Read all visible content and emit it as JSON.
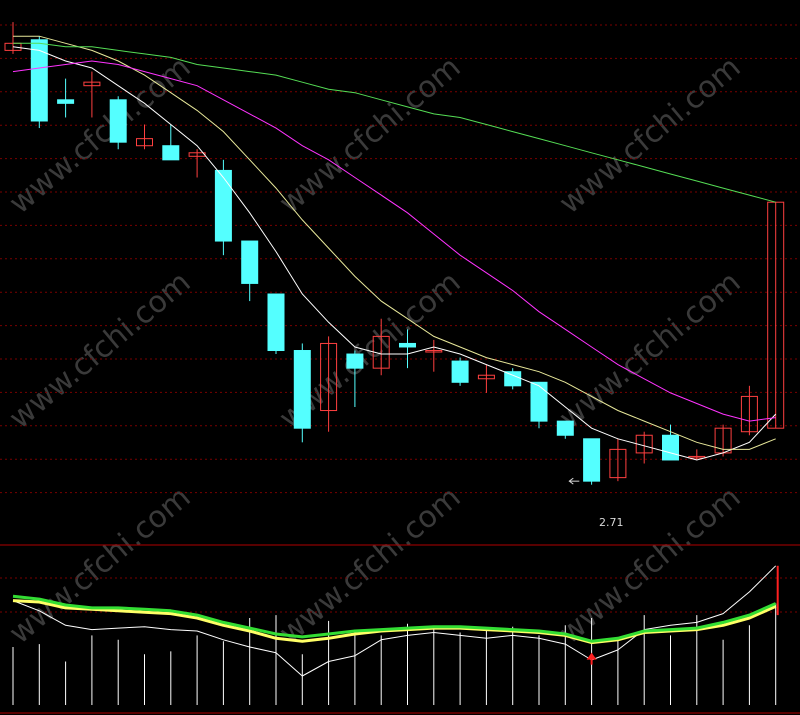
{
  "colors": {
    "background": "#000000",
    "grid": "#7a0000",
    "up_candle": "#ff4040",
    "down_candle": "#54ffff",
    "ma_white": "#ffffff",
    "ma_yellow": "#e8e89a",
    "ma_magenta": "#ff33ff",
    "ma_green": "#55dd55",
    "ind_yellow": "#ffff66",
    "ind_green": "#33dd33",
    "ind_white": "#ffffff",
    "signal_arrow": "#ff2020",
    "watermark": "#3a3a3a"
  },
  "watermark": "www.cfchi.com",
  "annotations": {
    "low_label": "2.71"
  },
  "chart_data": [
    {
      "type": "candlestick",
      "panel": "price",
      "ylim": [
        2.6,
        4.05
      ],
      "grid": true,
      "legend": "none",
      "low_marker": {
        "index": 21,
        "value": 2.71,
        "label": "2.71"
      },
      "candles": [
        {
          "o": 3.93,
          "c": 3.95,
          "h": 4.01,
          "l": 3.92
        },
        {
          "o": 3.96,
          "c": 3.73,
          "h": 3.97,
          "l": 3.71
        },
        {
          "o": 3.79,
          "c": 3.78,
          "h": 3.85,
          "l": 3.74
        },
        {
          "o": 3.83,
          "c": 3.84,
          "h": 3.87,
          "l": 3.74
        },
        {
          "o": 3.79,
          "c": 3.67,
          "h": 3.8,
          "l": 3.65
        },
        {
          "o": 3.66,
          "c": 3.68,
          "h": 3.72,
          "l": 3.65
        },
        {
          "o": 3.66,
          "c": 3.62,
          "h": 3.72,
          "l": 3.62
        },
        {
          "o": 3.63,
          "c": 3.64,
          "h": 3.65,
          "l": 3.57
        },
        {
          "o": 3.59,
          "c": 3.39,
          "h": 3.62,
          "l": 3.35
        },
        {
          "o": 3.39,
          "c": 3.27,
          "h": 3.39,
          "l": 3.22
        },
        {
          "o": 3.24,
          "c": 3.08,
          "h": 3.24,
          "l": 3.07
        },
        {
          "o": 3.08,
          "c": 2.86,
          "h": 3.1,
          "l": 2.82
        },
        {
          "o": 2.91,
          "c": 3.1,
          "h": 3.12,
          "l": 2.85
        },
        {
          "o": 3.07,
          "c": 3.03,
          "h": 3.08,
          "l": 2.92
        },
        {
          "o": 3.03,
          "c": 3.12,
          "h": 3.17,
          "l": 3.01
        },
        {
          "o": 3.1,
          "c": 3.09,
          "h": 3.14,
          "l": 3.03
        },
        {
          "o": 3.08,
          "c": 3.08,
          "h": 3.11,
          "l": 3.02
        },
        {
          "o": 3.05,
          "c": 2.99,
          "h": 3.06,
          "l": 2.98
        },
        {
          "o": 3.0,
          "c": 3.01,
          "h": 3.04,
          "l": 2.96
        },
        {
          "o": 3.02,
          "c": 2.98,
          "h": 3.03,
          "l": 2.97
        },
        {
          "o": 2.99,
          "c": 2.88,
          "h": 2.99,
          "l": 2.86
        },
        {
          "o": 2.88,
          "c": 2.84,
          "h": 2.88,
          "l": 2.83
        },
        {
          "o": 2.83,
          "c": 2.71,
          "h": 2.83,
          "l": 2.7
        },
        {
          "o": 2.72,
          "c": 2.8,
          "h": 2.83,
          "l": 2.71
        },
        {
          "o": 2.79,
          "c": 2.84,
          "h": 2.85,
          "l": 2.76
        },
        {
          "o": 2.84,
          "c": 2.77,
          "h": 2.87,
          "l": 2.77
        },
        {
          "o": 2.78,
          "c": 2.78,
          "h": 2.8,
          "l": 2.77
        },
        {
          "o": 2.79,
          "c": 2.86,
          "h": 2.87,
          "l": 2.78
        },
        {
          "o": 2.85,
          "c": 2.95,
          "h": 2.98,
          "l": 2.84
        },
        {
          "o": 2.86,
          "c": 3.5,
          "h": 3.5,
          "l": 2.86
        }
      ],
      "series": [
        {
          "color": "ma_white",
          "values": [
            3.94,
            3.93,
            3.9,
            3.88,
            3.83,
            3.78,
            3.72,
            3.66,
            3.57,
            3.47,
            3.36,
            3.24,
            3.16,
            3.09,
            3.07,
            3.07,
            3.09,
            3.07,
            3.04,
            3.01,
            2.98,
            2.92,
            2.86,
            2.83,
            2.81,
            2.79,
            2.77,
            2.79,
            2.82,
            2.9
          ]
        },
        {
          "color": "ma_yellow",
          "values": [
            3.97,
            3.97,
            3.95,
            3.93,
            3.9,
            3.86,
            3.81,
            3.76,
            3.7,
            3.62,
            3.54,
            3.45,
            3.37,
            3.29,
            3.22,
            3.17,
            3.12,
            3.09,
            3.06,
            3.04,
            3.02,
            2.99,
            2.95,
            2.91,
            2.88,
            2.85,
            2.82,
            2.8,
            2.8,
            2.83
          ]
        },
        {
          "color": "ma_magenta",
          "values": [
            3.87,
            3.88,
            3.89,
            3.9,
            3.89,
            3.87,
            3.85,
            3.83,
            3.79,
            3.75,
            3.71,
            3.66,
            3.62,
            3.57,
            3.52,
            3.47,
            3.41,
            3.35,
            3.3,
            3.25,
            3.19,
            3.14,
            3.09,
            3.04,
            3.0,
            2.96,
            2.93,
            2.9,
            2.88,
            2.89
          ]
        },
        {
          "color": "ma_green",
          "values": [
            3.95,
            3.95,
            3.94,
            3.94,
            3.93,
            3.92,
            3.91,
            3.89,
            3.88,
            3.87,
            3.86,
            3.84,
            3.82,
            3.81,
            3.79,
            3.77,
            3.75,
            3.74,
            3.72,
            3.7,
            3.68,
            3.66,
            3.64,
            3.62,
            3.6,
            3.58,
            3.56,
            3.54,
            3.52,
            3.5
          ]
        }
      ]
    },
    {
      "type": "line",
      "panel": "indicator",
      "ylim": [
        0,
        100
      ],
      "grid": true,
      "legend": "none",
      "bars": [
        40,
        42,
        30,
        48,
        45,
        35,
        37,
        48,
        44,
        60,
        62,
        35,
        58,
        52,
        48,
        56,
        54,
        50,
        52,
        54,
        48,
        55,
        60,
        46,
        62,
        48,
        62,
        45,
        55,
        70
      ],
      "signal_arrow_index": 22,
      "series": [
        {
          "color": "ind_white",
          "values": [
            72,
            65,
            55,
            52,
            53,
            54,
            52,
            51,
            45,
            40,
            36,
            20,
            30,
            34,
            45,
            48,
            50,
            48,
            46,
            48,
            46,
            42,
            31,
            38,
            52,
            55,
            57,
            63,
            78,
            96
          ]
        },
        {
          "color": "ind_yellow",
          "values": [
            72,
            71,
            67,
            66,
            65,
            64,
            63,
            60,
            55,
            51,
            46,
            44,
            46,
            49,
            51,
            52,
            53,
            53,
            52,
            51,
            50,
            48,
            43,
            45,
            50,
            51,
            52,
            55,
            60,
            68
          ]
        },
        {
          "color": "ind_green",
          "values": [
            75,
            73,
            69,
            67,
            67,
            66,
            65,
            62,
            57,
            53,
            49,
            47,
            49,
            51,
            52,
            53,
            54,
            54,
            53,
            52,
            51,
            49,
            44,
            46,
            51,
            52,
            53,
            57,
            62,
            70
          ]
        }
      ]
    }
  ]
}
